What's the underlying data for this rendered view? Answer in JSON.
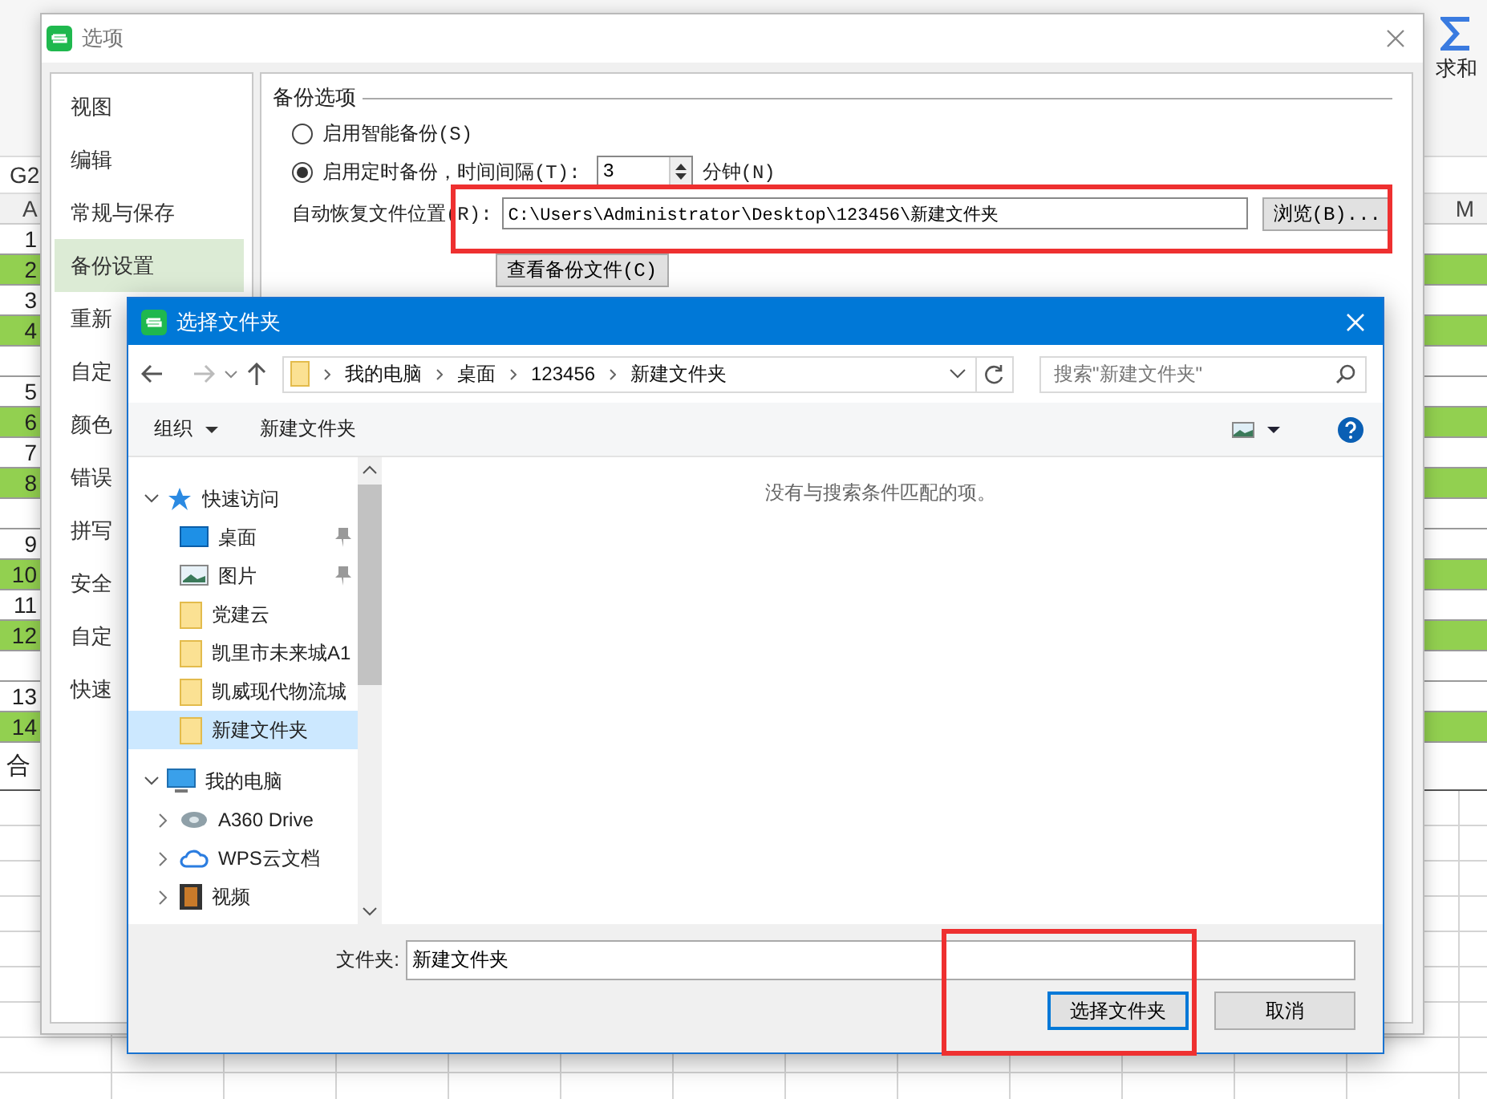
{
  "sheet": {
    "name_box": "G2",
    "column_headers": [
      {
        "label": "A"
      },
      {
        "label": "M"
      }
    ],
    "sum_label": "求和",
    "rows": [
      {
        "kind": "row",
        "label": "1",
        "filled": false
      },
      {
        "kind": "row",
        "label": "2",
        "filled": true
      },
      {
        "kind": "row",
        "label": "3",
        "filled": false
      },
      {
        "kind": "row",
        "label": "4",
        "filled": true
      },
      {
        "kind": "gap"
      },
      {
        "kind": "row",
        "label": "5",
        "filled": false
      },
      {
        "kind": "row",
        "label": "6",
        "filled": true
      },
      {
        "kind": "row",
        "label": "7",
        "filled": false
      },
      {
        "kind": "row",
        "label": "8",
        "filled": true
      },
      {
        "kind": "gap"
      },
      {
        "kind": "row",
        "label": "9",
        "filled": false
      },
      {
        "kind": "row",
        "label": "10",
        "filled": true
      },
      {
        "kind": "row",
        "label": "11",
        "filled": false
      },
      {
        "kind": "row",
        "label": "12",
        "filled": true
      },
      {
        "kind": "gap"
      },
      {
        "kind": "row",
        "label": "13",
        "filled": false
      },
      {
        "kind": "row",
        "label": "14",
        "filled": true
      }
    ],
    "total_label": "合"
  },
  "options_dialog": {
    "title": "选项",
    "nav": [
      {
        "label": "视图",
        "selected": false
      },
      {
        "label": "编辑",
        "selected": false
      },
      {
        "label": "常规与保存",
        "selected": false
      },
      {
        "label": "备份设置",
        "selected": true
      },
      {
        "label": "重新",
        "selected": false
      },
      {
        "label": "自定",
        "selected": false
      },
      {
        "label": "颜色",
        "selected": false
      },
      {
        "label": "错误",
        "selected": false
      },
      {
        "label": "拼写",
        "selected": false
      },
      {
        "label": "安全",
        "selected": false
      },
      {
        "label": "自定",
        "selected": false
      },
      {
        "label": "快速",
        "selected": false
      }
    ],
    "group_title": "备份选项",
    "radios": [
      {
        "label": "启用智能备份(S)",
        "selected": false
      },
      {
        "label": "启用定时备份，时间间隔(T):",
        "selected": true
      }
    ],
    "interval": {
      "value": "3",
      "unit": "分钟(N)"
    },
    "location_label": "自动恢复文件位置(R):",
    "location_value": "C:\\Users\\Administrator\\Desktop\\123456\\新建文件夹",
    "browse_button": "浏览(B)...",
    "view_backup_button": "查看备份文件(C)"
  },
  "folder_dialog": {
    "title": "选择文件夹",
    "breadcrumb": [
      "我的电脑",
      "桌面",
      "123456",
      "新建文件夹"
    ],
    "search_placeholder": "搜索\"新建文件夹\"",
    "toolbar": {
      "organize": "组织",
      "new_folder": "新建文件夹"
    },
    "empty_message": "没有与搜索条件匹配的项。",
    "tree": [
      {
        "label": "快速访问",
        "kind": "star",
        "expanded": true,
        "selected": false,
        "children": [
          {
            "label": "桌面",
            "kind": "desktop",
            "pinned": true,
            "selected": false
          },
          {
            "label": "图片",
            "kind": "image",
            "pinned": true,
            "selected": false
          },
          {
            "label": "党建云",
            "kind": "folder",
            "pinned": false,
            "selected": false
          },
          {
            "label": "凯里市未来城A1",
            "kind": "folder",
            "pinned": false,
            "selected": false
          },
          {
            "label": "凯威现代物流城",
            "kind": "folder",
            "pinned": false,
            "selected": false
          },
          {
            "label": "新建文件夹",
            "kind": "folder",
            "pinned": false,
            "selected": true
          }
        ]
      },
      {
        "label": "我的电脑",
        "kind": "computer",
        "expanded": true,
        "selected": false,
        "children": [
          {
            "label": "A360 Drive",
            "kind": "drive",
            "expanded": false,
            "selected": false
          },
          {
            "label": "WPS云文档",
            "kind": "cloud",
            "expanded": false,
            "selected": false
          },
          {
            "label": "视频",
            "kind": "film",
            "expanded": false,
            "selected": false
          }
        ]
      }
    ],
    "folder_label": "文件夹:",
    "folder_value": "新建文件夹",
    "buttons": [
      {
        "label": "选择文件夹",
        "default": true
      },
      {
        "label": "取消",
        "default": false
      }
    ]
  }
}
